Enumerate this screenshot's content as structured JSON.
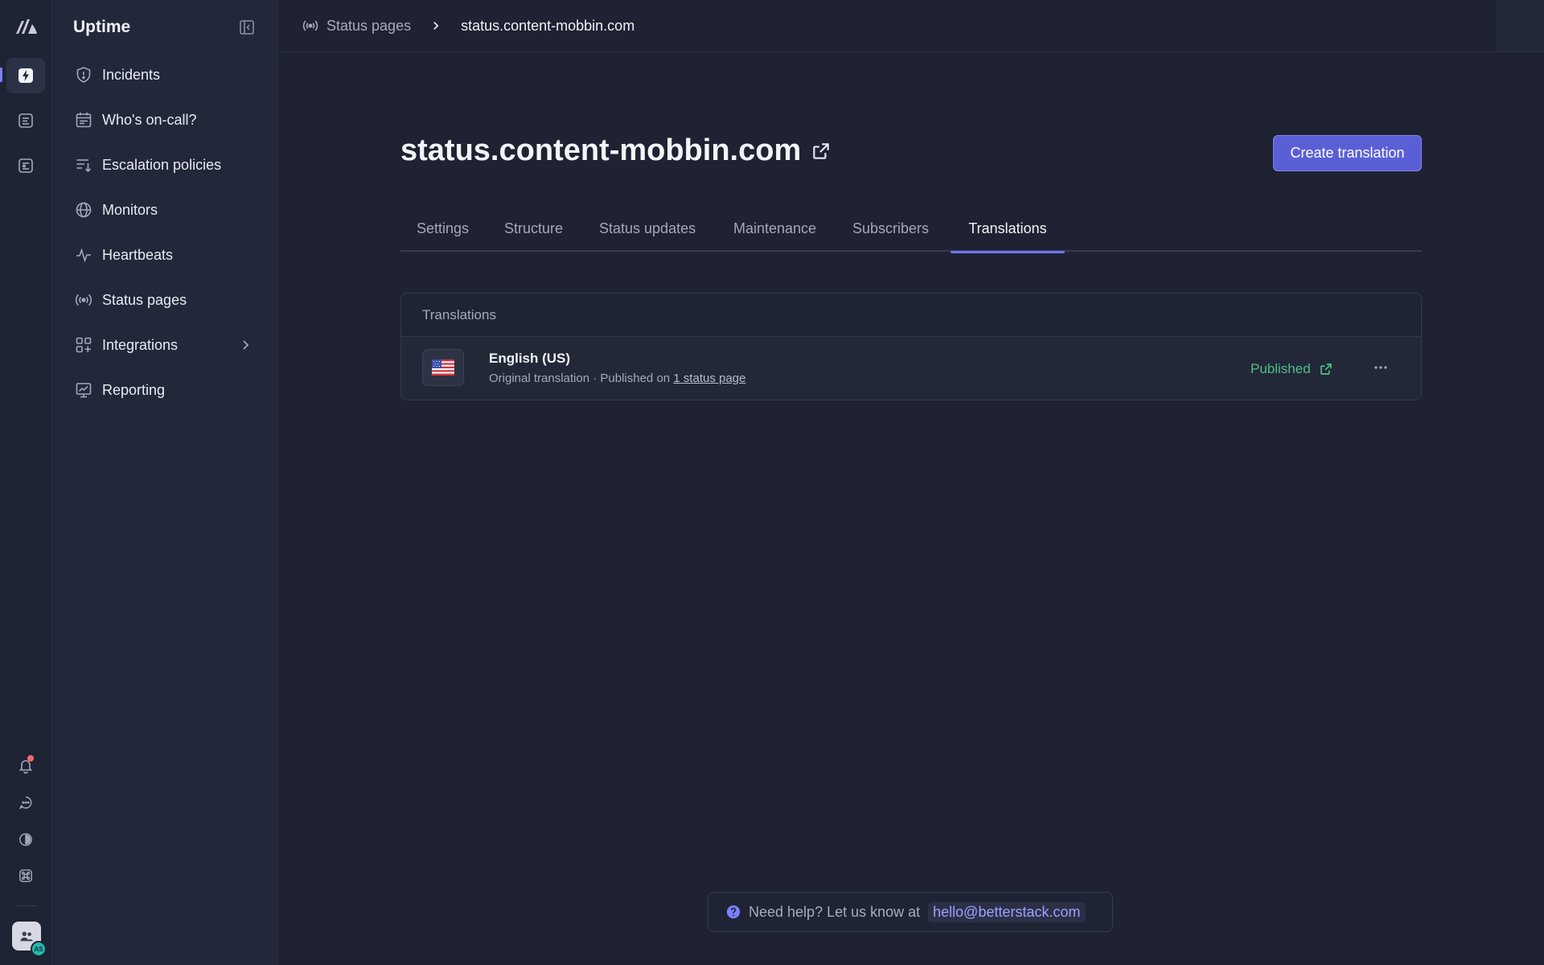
{
  "app": {
    "title": "Uptime"
  },
  "rail": {
    "icons": [
      "logo-icon",
      "incidents-rail-icon",
      "logs-rail-icon",
      "dashboards-rail-icon",
      "bell-icon",
      "chat-icon",
      "theme-icon",
      "command-icon",
      "team-avatar-icon"
    ],
    "avatar_initials": "AS"
  },
  "sidebar": {
    "items": [
      {
        "label": "Incidents",
        "icon": "shield-alert-icon"
      },
      {
        "label": "Who's on-call?",
        "icon": "calendar-icon"
      },
      {
        "label": "Escalation policies",
        "icon": "list-arrow-icon"
      },
      {
        "label": "Monitors",
        "icon": "globe-icon"
      },
      {
        "label": "Heartbeats",
        "icon": "pulse-icon"
      },
      {
        "label": "Status pages",
        "icon": "broadcast-icon"
      },
      {
        "label": "Integrations",
        "icon": "grid-plus-icon"
      },
      {
        "label": "Reporting",
        "icon": "chart-board-icon"
      }
    ]
  },
  "breadcrumb": {
    "parent": "Status pages",
    "current": "status.content-mobbin.com"
  },
  "page": {
    "title": "status.content-mobbin.com",
    "create_button": "Create translation"
  },
  "tabs": [
    {
      "label": "Settings",
      "active": false
    },
    {
      "label": "Structure",
      "active": false
    },
    {
      "label": "Status updates",
      "active": false
    },
    {
      "label": "Maintenance",
      "active": false
    },
    {
      "label": "Subscribers",
      "active": false
    },
    {
      "label": "Translations",
      "active": true
    }
  ],
  "translations": {
    "header": "Translations",
    "rows": [
      {
        "language": "English (US)",
        "meta_prefix": "Original translation · Published on",
        "meta_link": "1 status page",
        "status": "Published"
      }
    ]
  },
  "help": {
    "text": "Need help? Let us know at",
    "email": "hello@betterstack.com"
  },
  "colors": {
    "accent": "#5b5fd6",
    "published": "#4fbf86",
    "background": "#1e2232"
  }
}
